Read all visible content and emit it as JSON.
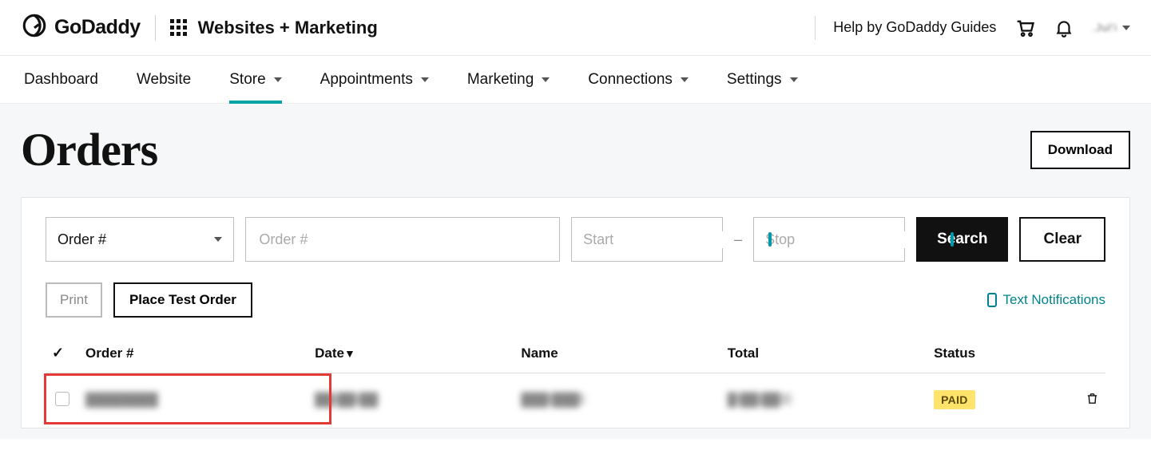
{
  "header": {
    "brand": "GoDaddy",
    "section": "Websites + Marketing",
    "help": "Help by GoDaddy Guides",
    "user": ".Jul'i"
  },
  "nav": {
    "items": [
      {
        "label": "Dashboard",
        "dropdown": false
      },
      {
        "label": "Website",
        "dropdown": false
      },
      {
        "label": "Store",
        "dropdown": true,
        "active": true
      },
      {
        "label": "Appointments",
        "dropdown": true
      },
      {
        "label": "Marketing",
        "dropdown": true
      },
      {
        "label": "Connections",
        "dropdown": true
      },
      {
        "label": "Settings",
        "dropdown": true
      }
    ]
  },
  "page": {
    "title": "Orders",
    "download": "Download"
  },
  "filters": {
    "selector_label": "Order #",
    "search_placeholder": "Order #",
    "start_placeholder": "Start",
    "stop_placeholder": "Stop",
    "search_btn": "Search",
    "clear_btn": "Clear",
    "dash": "–"
  },
  "actions": {
    "print": "Print",
    "place_test": "Place Test Order",
    "text_notifications": "Text Notifications"
  },
  "table": {
    "columns": {
      "order": "Order #",
      "date": "Date",
      "name": "Name",
      "total": "Total",
      "status": "Status"
    },
    "rows": [
      {
        "order": "████████",
        "date": "██-██-██",
        "name": "███ ███",
        "total": "█ ██.██",
        "status": "PAID"
      }
    ]
  }
}
